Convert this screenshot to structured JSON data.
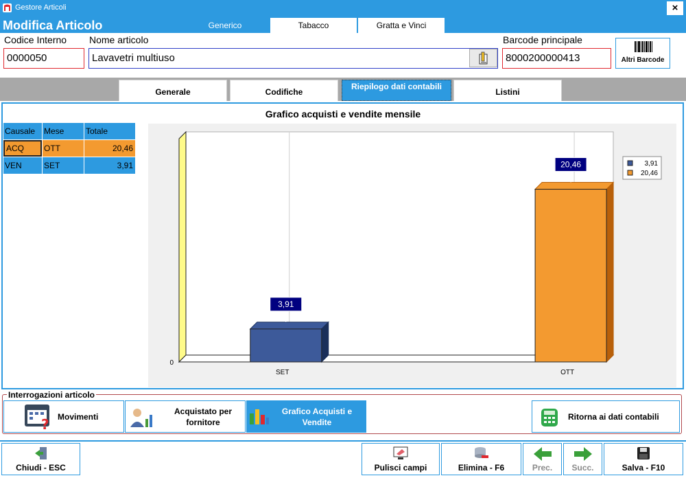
{
  "window": {
    "title": "Gestore Articoli",
    "close_glyph": "×"
  },
  "header": {
    "title": "Modifica Articolo",
    "tabs": [
      {
        "label": "Generico",
        "active": true
      },
      {
        "label": "Tabacco",
        "active": false
      },
      {
        "label": "Gratta e Vinci",
        "active": false
      }
    ]
  },
  "fields": {
    "codice_label": "Codice Interno",
    "codice_value": "0000050",
    "nome_label": "Nome articolo",
    "nome_value": "Lavavetri multiuso",
    "barcode_label": "Barcode principale",
    "barcode_value": "8000200000413",
    "altri_barcode": "Altri Barcode"
  },
  "subtabs": [
    {
      "label": "Generale",
      "active": false
    },
    {
      "label": "Codifiche",
      "active": false
    },
    {
      "label": "Riepilogo dati contabili",
      "active": true
    },
    {
      "label": "Listini",
      "active": false
    }
  ],
  "summary_table": {
    "headers": [
      "Causale",
      "Mese",
      "Totale"
    ],
    "rows": [
      {
        "causale": "ACQ",
        "mese": "OTT",
        "totale": "20,46",
        "color": "#f39a30"
      },
      {
        "causale": "VEN",
        "mese": "SET",
        "totale": "3,91",
        "color": "#2d9ae0"
      }
    ]
  },
  "chart_data": {
    "type": "bar",
    "title": "Grafico acquisti e vendite mensile",
    "categories": [
      "SET",
      "OTT"
    ],
    "series": [
      {
        "name": "3,91",
        "values": [
          3.91,
          null
        ],
        "color": "#3d5a9a"
      },
      {
        "name": "20,46",
        "values": [
          null,
          20.46
        ],
        "color": "#f39a30"
      }
    ],
    "data_labels": [
      "3,91",
      "20,46"
    ],
    "y_tick": "0",
    "ylim": [
      0,
      24
    ],
    "legend": "top-right",
    "grid": false
  },
  "group": {
    "title": "Interrogazioni articolo",
    "buttons": [
      {
        "label": "Movimenti",
        "icon": "calendar-question-icon"
      },
      {
        "label": "Acquistato per fornitore",
        "icon": "users-chart-icon"
      },
      {
        "label": "Grafico Acquisti e Vendite",
        "icon": "bar-chart-icon"
      },
      {
        "label": "Ritorna ai dati contabili",
        "icon": "calculator-icon"
      }
    ]
  },
  "footer": {
    "chiudi": "Chiudi - ESC",
    "pulisci": "Pulisci campi",
    "elimina": "Elimina - F6",
    "prec": "Prec.",
    "succ": "Succ.",
    "salva": "Salva - F10"
  },
  "colors": {
    "accent": "#2d9ae0",
    "orange": "#f39a30",
    "navy": "#3d5a9a",
    "label_bg": "#000080"
  }
}
